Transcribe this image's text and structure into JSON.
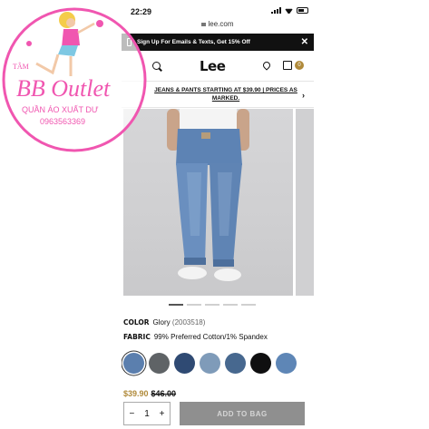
{
  "status": {
    "time": "22:29"
  },
  "browser": {
    "url": "lee.com"
  },
  "promo": {
    "text": "Sign Up For Emails & Texts, Get 15% Off",
    "close_icon": "close-icon"
  },
  "header": {
    "logo": "Lee",
    "cart_count": "0"
  },
  "announcement": {
    "text": "JEANS & PANTS STARTING AT $39.90 | PRICES AS MARKED.",
    "chevron": "›"
  },
  "gallery": {
    "slides": 5,
    "active_index": 0
  },
  "product": {
    "color_label": "COLOR",
    "color_name": "Glory",
    "color_code": "(2003518)",
    "fabric_label": "FABRIC",
    "fabric_value": "99% Preferred Cotton/1% Spandex",
    "swatches": [
      "#5b7fae",
      "#5f6366",
      "#2f4a73",
      "#7f9bb9",
      "#47688f",
      "#0f0f10",
      "#5e86b6"
    ],
    "price_sale": "$39.90",
    "price_original": "$46.00",
    "quantity": "1",
    "quantity_minus": "−",
    "quantity_plus": "+",
    "add_to_bag": "ADD TO BAG"
  },
  "watermark": {
    "brand": "BB Outlet",
    "tagline": "QUẦN ÁO XUẤT DƯ",
    "phone": "0963563369",
    "arc_text": "TÂM"
  },
  "colors": {
    "accent_gold": "#b08a3a",
    "watermark_pink": "#f056b0",
    "button_gray": "#8f8f8f"
  }
}
